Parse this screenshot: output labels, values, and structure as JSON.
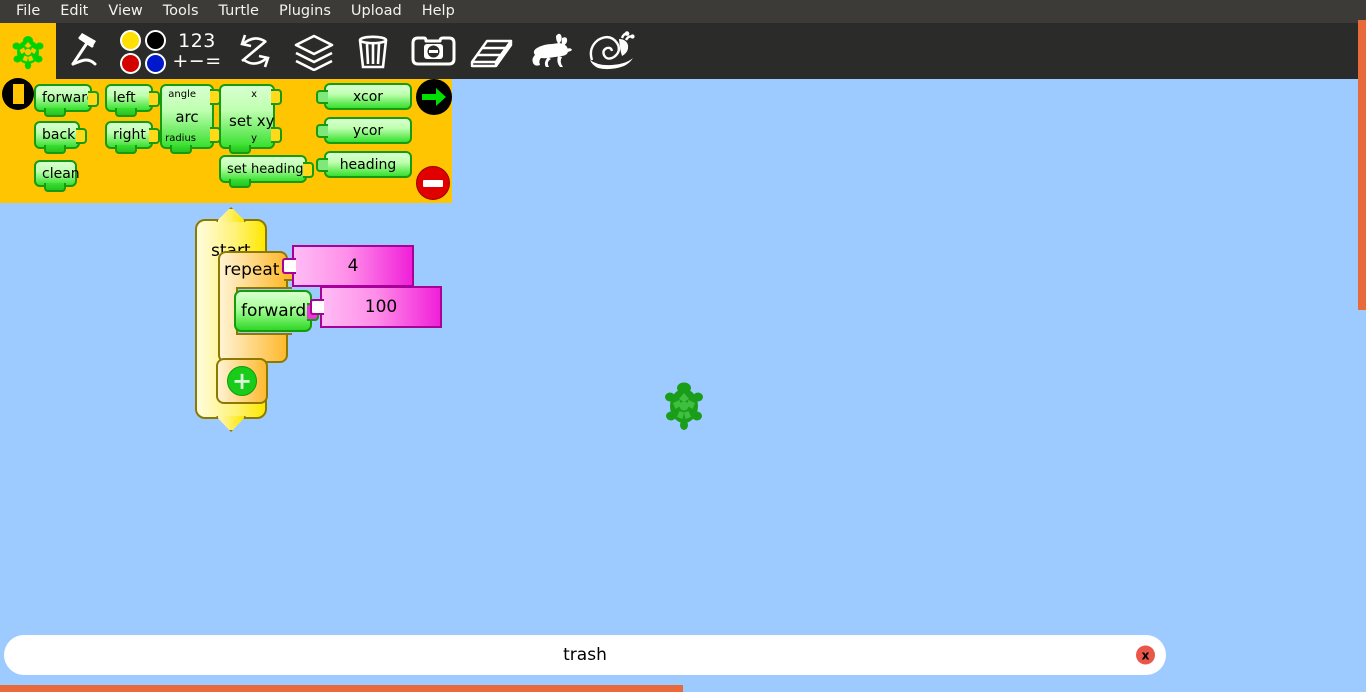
{
  "menubar": {
    "items": [
      {
        "label": "File"
      },
      {
        "label": "Edit"
      },
      {
        "label": "View"
      },
      {
        "label": "Tools"
      },
      {
        "label": "Turtle"
      },
      {
        "label": "Plugins"
      },
      {
        "label": "Upload"
      },
      {
        "label": "Help"
      }
    ]
  },
  "toolbar": {
    "logo_icon": "turtle-logo-icon",
    "items": [
      {
        "icon": "pen-icon",
        "name": "pen-tool"
      },
      {
        "icon": "color-swatches-icon",
        "name": "color-palette"
      },
      {
        "icon": "numbers-icon",
        "name": "numbers-palette",
        "glyph_top": "123",
        "glyph_bottom": "+−="
      },
      {
        "icon": "refresh-arrows-icon",
        "name": "flow-palette"
      },
      {
        "icon": "open-box-icon",
        "name": "blocks-palette"
      },
      {
        "icon": "trash-icon",
        "name": "trash-palette"
      },
      {
        "icon": "hide-blocks-icon",
        "name": "hide-blocks"
      },
      {
        "icon": "eraser-icon",
        "name": "eraser"
      },
      {
        "icon": "rabbit-icon",
        "name": "run-fast"
      },
      {
        "icon": "snail-icon",
        "name": "run-slow"
      }
    ],
    "swatch_colors": [
      "#FFE000",
      "#000000",
      "#D40000",
      "#0018CC"
    ]
  },
  "palette": {
    "category_color": "#FFC500",
    "category_indicator": "turtle-category",
    "blocks": [
      {
        "label": "forward",
        "type": "command",
        "has_socket": true
      },
      {
        "label": "back",
        "type": "command",
        "has_socket": true
      },
      {
        "label": "clean",
        "type": "command",
        "has_socket": false
      },
      {
        "label": "left",
        "type": "command",
        "has_socket": true
      },
      {
        "label": "right",
        "type": "command",
        "has_socket": true
      },
      {
        "label": "arc",
        "type": "command",
        "args": [
          "angle",
          "radius"
        ]
      },
      {
        "label": "set xy",
        "type": "command",
        "args": [
          "x",
          "y"
        ]
      },
      {
        "label": "set heading",
        "type": "command",
        "has_socket": true
      },
      {
        "label": "xcor",
        "type": "reporter"
      },
      {
        "label": "ycor",
        "type": "reporter"
      },
      {
        "label": "heading",
        "type": "reporter"
      }
    ],
    "run_button": "run-green-arrow",
    "stop_button": "stop-button"
  },
  "program": {
    "start_label": "start",
    "repeat_label": "repeat",
    "repeat_value": "4",
    "forward_label": "forward",
    "forward_value": "100",
    "plus_label": "+",
    "turtle_sprite": "turtle-sprite"
  },
  "trash": {
    "label": "trash",
    "close_label": "x"
  },
  "colors": {
    "canvas_background": "#9ECBFF",
    "palette_background": "#FFC500",
    "menu_background": "#3C3B37",
    "toolbar_background": "#2B2B29",
    "scrollbar": "#E8693A",
    "block_green": "#37E02E",
    "block_yellow": "#FFE800",
    "block_orange": "#FFB92E",
    "block_magenta": "#F020D8"
  }
}
